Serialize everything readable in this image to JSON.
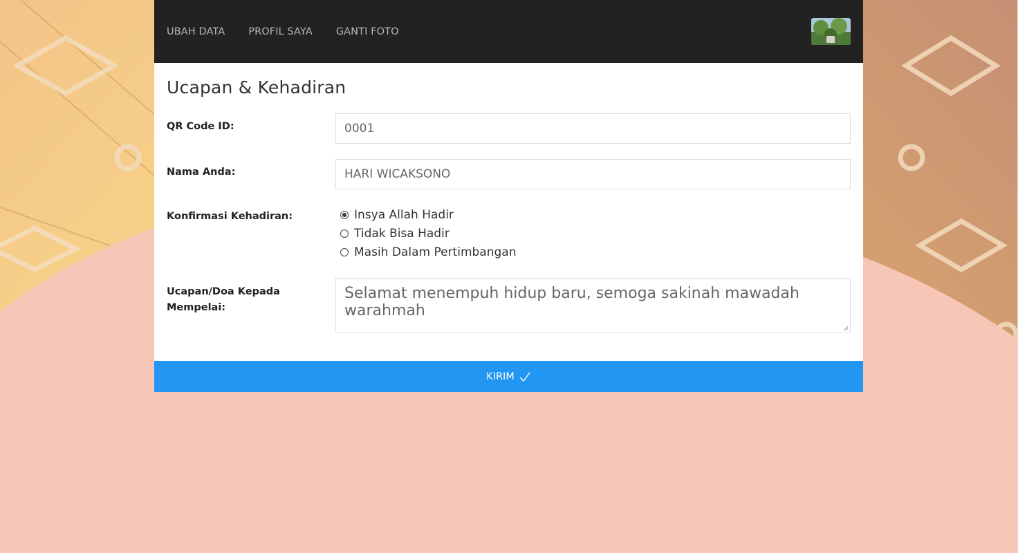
{
  "nav": {
    "links": [
      {
        "label": "UBAH DATA"
      },
      {
        "label": "PROFIL SAYA"
      },
      {
        "label": "GANTI FOTO"
      }
    ],
    "avatar_icon": "profile-photo"
  },
  "form": {
    "title": "Ucapan & Kehadiran",
    "qr": {
      "label": "QR Code ID:",
      "value": "0001"
    },
    "name": {
      "label": "Nama Anda:",
      "value": "HARI WICAKSONO"
    },
    "attendance": {
      "label": "Konfirmasi Kehadiran:",
      "options": [
        {
          "label": "Insya Allah Hadir",
          "checked": true
        },
        {
          "label": "Tidak Bisa Hadir",
          "checked": false
        },
        {
          "label": "Masih Dalam Pertimbangan",
          "checked": false
        }
      ]
    },
    "message": {
      "label": "Ucapan/Doa Kepada Mempelai:",
      "value": "Selamat menempuh hidup baru, semoga sakinah mawadah warahmah"
    },
    "submit_label": "KIRIM",
    "submit_icon": "checkmark-icon"
  },
  "colors": {
    "navbar": "#222222",
    "accent": "#2196f3",
    "background": "#f6c7b6"
  }
}
